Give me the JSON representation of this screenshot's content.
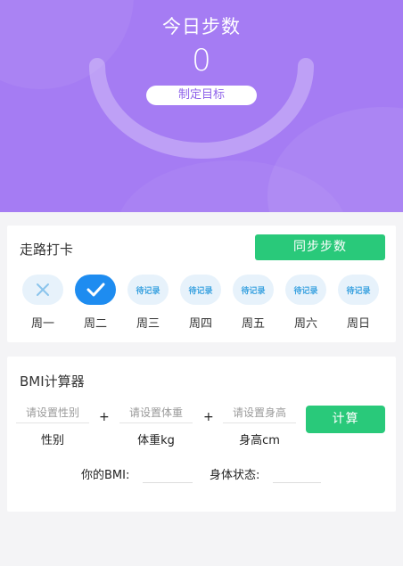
{
  "header": {
    "title": "今日步数",
    "steps": "0",
    "goal_button": "制定目标"
  },
  "checkin": {
    "title": "走路打卡",
    "sync_button": "同步步数",
    "days": [
      {
        "label": "周一",
        "status": "missed",
        "text": ""
      },
      {
        "label": "周二",
        "status": "done",
        "text": ""
      },
      {
        "label": "周三",
        "status": "pending",
        "text": "待记录"
      },
      {
        "label": "周四",
        "status": "pending",
        "text": "待记录"
      },
      {
        "label": "周五",
        "status": "pending",
        "text": "待记录"
      },
      {
        "label": "周六",
        "status": "pending",
        "text": "待记录"
      },
      {
        "label": "周日",
        "status": "pending",
        "text": "待记录"
      }
    ]
  },
  "bmi": {
    "title": "BMI计算器",
    "gender_placeholder": "请设置性别",
    "gender_label": "性别",
    "weight_placeholder": "请设置体重",
    "weight_label": "体重kg",
    "height_placeholder": "请设置身高",
    "height_label": "身高cm",
    "plus": "+",
    "calc_button": "计算",
    "result_label": "你的BMI:",
    "status_label": "身体状态:"
  },
  "colors": {
    "header_bg": "#a57cf3",
    "green_button": "#29c97a",
    "check_blue": "#1e8cf0"
  }
}
